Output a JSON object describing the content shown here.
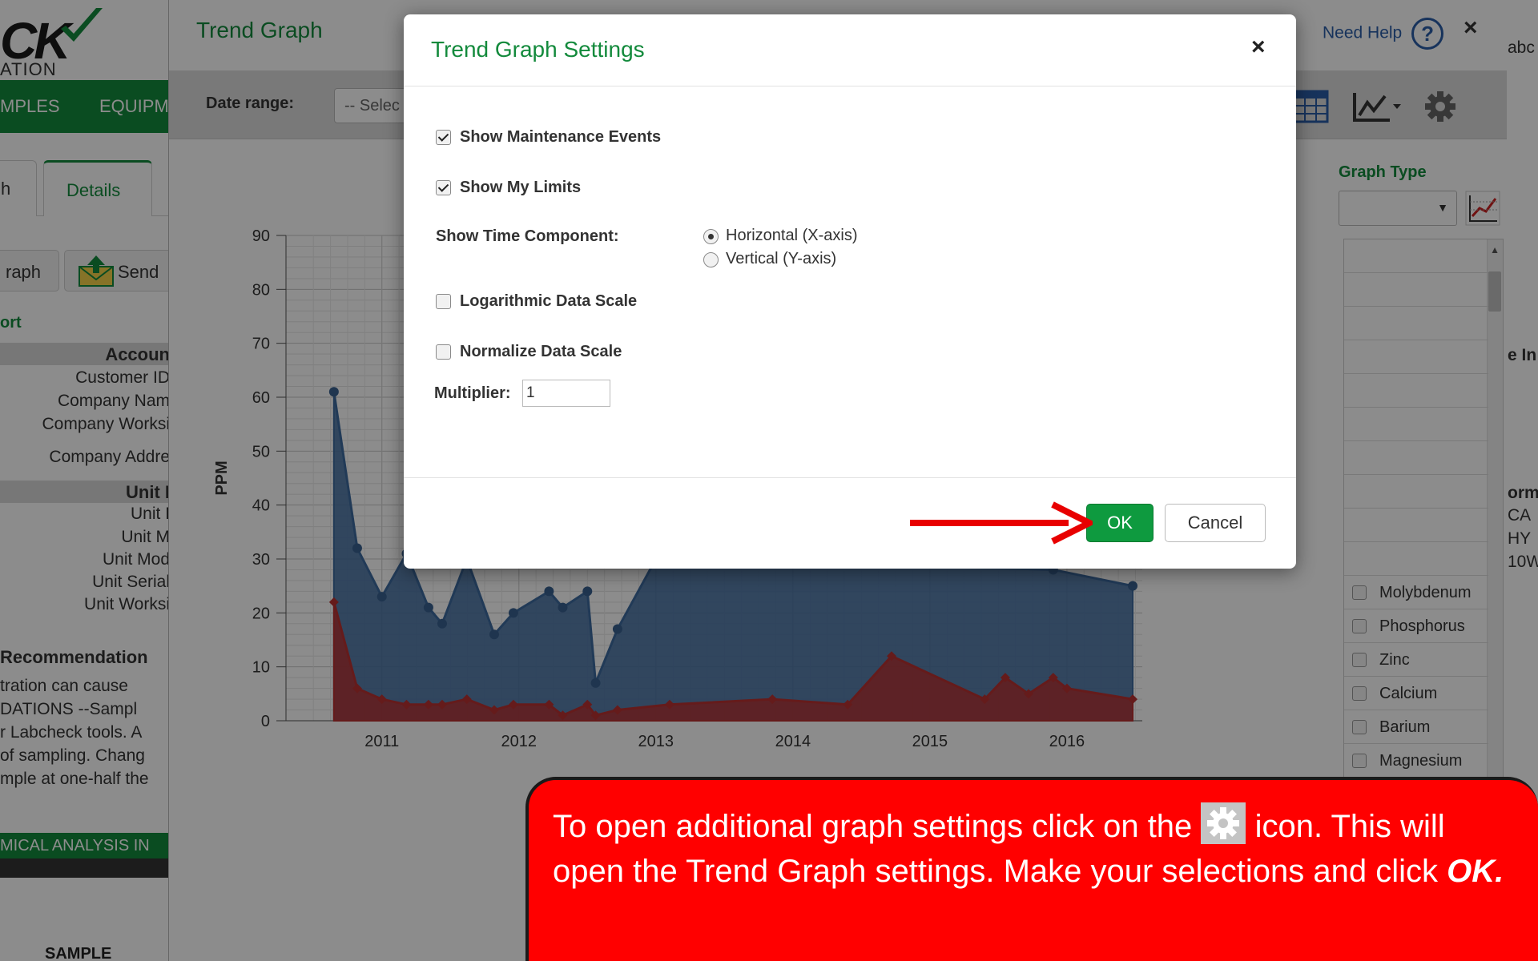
{
  "background": {
    "logo_text": "CK",
    "logo_subtext": "ATION",
    "nav_items": [
      "MPLES",
      "EQUIPM"
    ],
    "tabs": [
      "h",
      "Details"
    ],
    "buttons": [
      "raph",
      "Send"
    ],
    "report_link": "ort",
    "account_header": "Accoun",
    "account_rows": [
      "Customer ID",
      "Company Nam",
      "Company Worksi",
      "Company Addre"
    ],
    "unit_header": "Unit I",
    "unit_rows": [
      "Unit I",
      "Unit M",
      "Unit Mod",
      "Unit Serial",
      "Unit Worksi"
    ],
    "recommendation_title": "Recommendation",
    "recommendation_lines": [
      "tration can cause",
      "DATIONS --Sampl",
      "r Labcheck tools. A",
      "of sampling. Chang",
      "mple at one-half the"
    ],
    "chemical_bar": "MICAL ANALYSIS IN",
    "sample_label": "SAMPLE",
    "right_edge_texts": [
      "abc",
      "e In",
      "orm",
      "CA",
      "HY",
      "10W"
    ]
  },
  "trend_window": {
    "title": "Trend Graph",
    "need_help": "Need Help",
    "help_symbol": "?",
    "close_symbol": "×",
    "date_range_label": "Date range:",
    "date_range_value": "-- Selec",
    "graph_type_label": "Graph Type",
    "elements": [
      "Molybdenum",
      "Phosphorus",
      "Zinc",
      "Calcium",
      "Barium",
      "Magnesium"
    ]
  },
  "modal": {
    "title": "Trend Graph Settings",
    "close_symbol": "×",
    "show_maintenance_events": {
      "label": "Show Maintenance Events",
      "checked": true
    },
    "show_my_limits": {
      "label": "Show My Limits",
      "checked": true
    },
    "time_component_label": "Show Time Component:",
    "time_options": [
      {
        "label": "Horizontal (X-axis)",
        "selected": true
      },
      {
        "label": "Vertical (Y-axis)",
        "selected": false
      }
    ],
    "logarithmic_scale": {
      "label": "Logarithmic Data Scale",
      "checked": false
    },
    "normalize_scale": {
      "label": "Normalize Data Scale",
      "checked": false
    },
    "multiplier_label": "Multiplier:",
    "multiplier_value": "1",
    "ok_label": "OK",
    "cancel_label": "Cancel"
  },
  "callout": {
    "text_before_icon": "To open additional graph settings click on the",
    "text_after_icon": "icon.  This will open the Trend Graph settings.  Make your selections and click",
    "emphasis": "OK."
  },
  "colors": {
    "brand_green": "#138a3c",
    "ok_green": "#0e9a3f",
    "series_blue": "#3d6a9e",
    "series_red": "#b83232",
    "callout_red": "#ff0000"
  },
  "chart_data": {
    "type": "area",
    "ylabel": "PPM",
    "ylim": [
      0,
      90
    ],
    "y_ticks": [
      0,
      10,
      20,
      30,
      40,
      50,
      60,
      70,
      80,
      90
    ],
    "x_ticks": [
      "2011",
      "2012",
      "2013",
      "2014",
      "2015",
      "2016"
    ],
    "series": [
      {
        "color": "#3d6a9e",
        "x": [
          2010.65,
          2010.82,
          2011.0,
          2011.18,
          2011.34,
          2011.44,
          2011.62,
          2011.82,
          2011.96,
          2012.22,
          2012.32,
          2012.5,
          2012.56,
          2012.72,
          2013.0,
          2015.9,
          2016.48
        ],
        "values": [
          61,
          32,
          23,
          31,
          21,
          18,
          30,
          16,
          20,
          24,
          21,
          24,
          7,
          17,
          30,
          28,
          25
        ]
      },
      {
        "color": "#b83232",
        "x": [
          2010.65,
          2010.82,
          2011.0,
          2011.18,
          2011.34,
          2011.44,
          2011.62,
          2011.82,
          2011.96,
          2012.22,
          2012.32,
          2012.5,
          2012.56,
          2012.72,
          2013.1,
          2013.85,
          2014.4,
          2014.72,
          2015.4,
          2015.55,
          2015.72,
          2015.9,
          2016.0,
          2016.48
        ],
        "values": [
          22,
          6,
          4,
          3,
          3,
          3,
          4,
          2,
          3,
          3,
          1,
          3,
          1,
          2,
          3,
          4,
          3,
          12,
          4,
          8,
          5,
          8,
          6,
          4
        ]
      }
    ]
  }
}
